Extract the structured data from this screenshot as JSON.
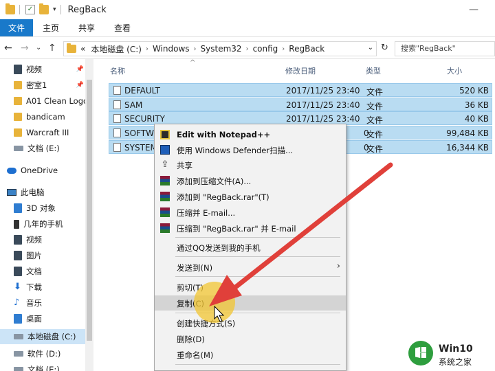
{
  "window": {
    "title": "RegBack",
    "minimize": "—"
  },
  "ribbon": {
    "tabs": [
      {
        "label": "文件"
      },
      {
        "label": "主页"
      },
      {
        "label": "共享"
      },
      {
        "label": "查看"
      }
    ]
  },
  "nav": {
    "back": "←",
    "forward": "→",
    "recent": "⌄",
    "up": "↑",
    "refresh": "↻"
  },
  "address": {
    "prefix": "«",
    "crumbs": [
      "本地磁盘 (C:)",
      "Windows",
      "System32",
      "config",
      "RegBack"
    ],
    "separator": "›",
    "dropdown": "⌄"
  },
  "search": {
    "placeholder": "搜索\"RegBack\""
  },
  "sidebar": {
    "items": [
      {
        "label": "视频",
        "icon": "video-icon",
        "pinned": true
      },
      {
        "label": "密室1",
        "icon": "folder-icon",
        "pinned": true
      },
      {
        "label": "A01 Clean Logo",
        "icon": "folder-icon"
      },
      {
        "label": "bandicam",
        "icon": "folder-icon"
      },
      {
        "label": "Warcraft III",
        "icon": "folder-icon"
      },
      {
        "label": "文档 (E:)",
        "icon": "drive-icon"
      },
      {
        "label": "OneDrive",
        "icon": "cloud-icon"
      },
      {
        "label": "此电脑",
        "icon": "computer-icon"
      },
      {
        "label": "3D 对象",
        "icon": "3d-objects-icon"
      },
      {
        "label": "几年的手机",
        "icon": "phone-icon"
      },
      {
        "label": "视频",
        "icon": "video-icon"
      },
      {
        "label": "图片",
        "icon": "pictures-icon"
      },
      {
        "label": "文档",
        "icon": "documents-icon"
      },
      {
        "label": "下载",
        "icon": "download-icon"
      },
      {
        "label": "音乐",
        "icon": "music-icon"
      },
      {
        "label": "桌面",
        "icon": "desktop-icon"
      },
      {
        "label": "本地磁盘 (C:)",
        "icon": "drive-icon",
        "selected": true
      },
      {
        "label": "软件 (D:)",
        "icon": "drive-icon"
      },
      {
        "label": "文档 (E:)",
        "icon": "drive-icon"
      }
    ],
    "pin_glyph": "📌"
  },
  "columns": {
    "name": "名称",
    "date": "修改日期",
    "type": "类型",
    "size": "大小",
    "sort_glyph": "^"
  },
  "files": [
    {
      "name": "DEFAULT",
      "date": "2017/11/25 23:40",
      "type": "文件",
      "size": "520 KB"
    },
    {
      "name": "SAM",
      "date": "2017/11/25 23:40",
      "type": "文件",
      "size": "36 KB"
    },
    {
      "name": "SECURITY",
      "date": "2017/11/25 23:40",
      "type": "文件",
      "size": "40 KB"
    },
    {
      "name": "SOFTW",
      "date": "0",
      "type": "文件",
      "size": "99,484 KB"
    },
    {
      "name": "SYSTEM",
      "date": "0",
      "type": "文件",
      "size": "16,344 KB"
    }
  ],
  "context_menu": {
    "items": [
      {
        "label": "Edit with Notepad++",
        "icon": "notepad-icon"
      },
      {
        "label": "使用 Windows Defender扫描...",
        "icon": "defender-shield-icon"
      },
      {
        "label": "共享",
        "icon": "share-icon"
      },
      {
        "label": "添加到压缩文件(A)...",
        "icon": "winrar-icon"
      },
      {
        "label": "添加到 \"RegBack.rar\"(T)",
        "icon": "winrar-icon"
      },
      {
        "label": "压缩并 E-mail...",
        "icon": "winrar-icon"
      },
      {
        "label": "压缩到 \"RegBack.rar\" 并 E-mail",
        "icon": "winrar-icon"
      },
      {
        "label": "通过QQ发送到我的手机"
      },
      {
        "label": "发送到(N)",
        "submenu": "›"
      },
      {
        "label": "剪切(T)"
      },
      {
        "label": "复制(C)",
        "highlighted": true
      },
      {
        "label": "创建快捷方式(S)"
      },
      {
        "label": "删除(D)"
      },
      {
        "label": "重命名(M)"
      }
    ]
  },
  "watermark": {
    "title": "Win10",
    "subtitle": "系统之家"
  },
  "colors": {
    "accent": "#1979ca",
    "selection": "#b9dcf2",
    "arrow": "#e0403a",
    "cursor_glow": "#f2c531"
  }
}
